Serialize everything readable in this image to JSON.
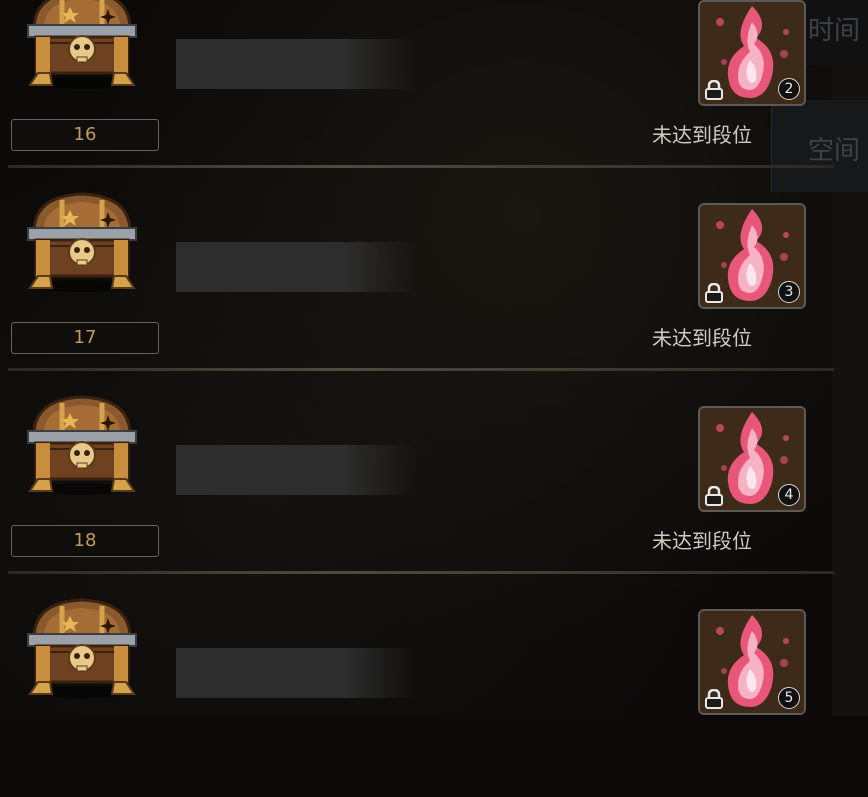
{
  "colors": {
    "level_text": "#c29c5a",
    "status_text": "#cfcac2",
    "reward_bg": "#3a2817",
    "flame": "#e8567a"
  },
  "rows": [
    {
      "level": "16",
      "status": "未达到段位",
      "reward_count": "2",
      "chest_icon": "skull-chest-icon",
      "reward_icon": "pink-flame-icon"
    },
    {
      "level": "17",
      "status": "未达到段位",
      "reward_count": "3",
      "chest_icon": "skull-chest-icon",
      "reward_icon": "pink-flame-icon"
    },
    {
      "level": "18",
      "status": "未达到段位",
      "reward_count": "4",
      "chest_icon": "skull-chest-icon",
      "reward_icon": "pink-flame-icon"
    },
    {
      "level": "",
      "status": "",
      "reward_count": "5",
      "chest_icon": "skull-chest-icon",
      "reward_icon": "pink-flame-icon"
    }
  ],
  "background": {
    "right_tab_1": "时间",
    "right_tab_2": "空间"
  }
}
